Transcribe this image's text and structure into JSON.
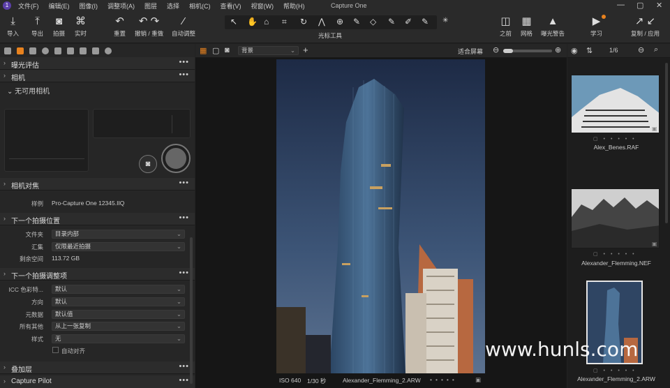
{
  "app": {
    "title": "Capture One"
  },
  "menu": [
    "文件(F)",
    "编辑(E)",
    "图像(I)",
    "调整项(A)",
    "图层",
    "选择",
    "相机(C)",
    "查看(V)",
    "视窗(W)",
    "帮助(H)"
  ],
  "toolbar": {
    "import": "导入",
    "export": "导出",
    "capture": "拍摄",
    "live": "实时",
    "reset": "重置",
    "undo_redo": "撤销 / 重做",
    "auto_adjust": "自动调整",
    "cursor_tools": "光标工具",
    "before": "之前",
    "grid": "网格",
    "exposure_warning": "曝光警告",
    "learn": "学习",
    "copy_apply": "复制 / 应用"
  },
  "left_panel": {
    "exposure_eval": "曝光评估",
    "camera": "相机",
    "no_camera": "无可用相机",
    "camera_focus": "相机对焦",
    "sample_label": "样例",
    "sample_value": "Pro-Capture One 12345.IIQ",
    "next_capture_location": "下一个拍摄位置",
    "folder_label": "文件夹",
    "folder_value": "目录内部",
    "collection_label": "汇集",
    "collection_value": "仅限最近拍摄",
    "space_label": "剩余空间",
    "space_value": "113.72 GB",
    "next_capture_adjustments": "下一个拍摄调整项",
    "icc_label": "ICC 色彩特...",
    "icc_value": "默认",
    "orientation_label": "方向",
    "orientation_value": "默认",
    "metadata_label": "元数据",
    "metadata_value": "默认值",
    "others_label": "所有其他",
    "others_value": "从上一张复制",
    "styles_label": "样式",
    "styles_value": "无",
    "auto_align": "自动对齐",
    "overlay": "叠加层",
    "capture_pilot": "Capture Pilot"
  },
  "viewer": {
    "variant_select": "背景",
    "fit_screen": "适合屏幕",
    "iso": "ISO 640",
    "shutter": "1/30 秒",
    "filename": "Alexander_Flemming_2.ARW"
  },
  "browser": {
    "counter": "1/6",
    "thumbs": [
      {
        "name": "Alex_Benes.RAF"
      },
      {
        "name": "Alexander_Flemming.NEF"
      },
      {
        "name": "Alexander_Flemming_2.ARW"
      }
    ]
  },
  "watermark": "www.hunls.com",
  "colors": {
    "accent": "#e8821e",
    "brand": "#5b3fa8",
    "bg": "#222222"
  }
}
